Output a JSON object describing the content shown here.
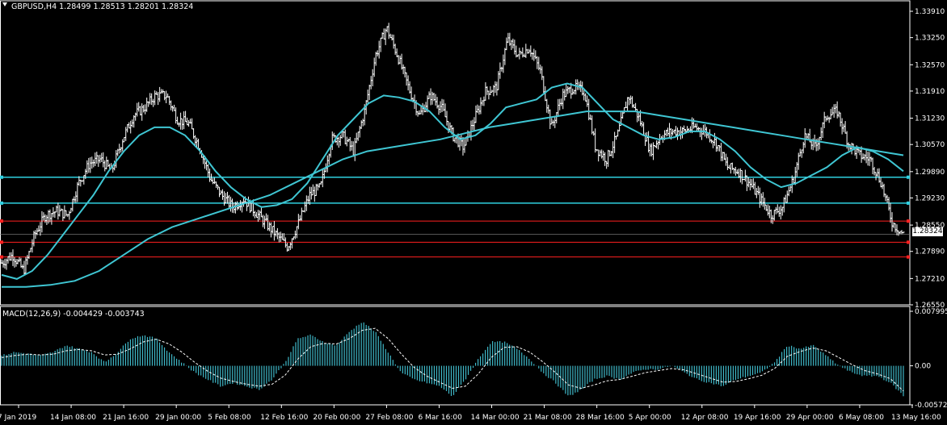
{
  "window": {
    "header": "GBPUSD,H4  1.28499 1.28513 1.28201 1.28324",
    "price_tag": "1.28324"
  },
  "indicator": {
    "header": "MACD(12,26,9) -0.004429 -0.003743"
  },
  "colors": {
    "background": "#000000",
    "candles": "#ffffff",
    "moving_average": "#3fc6d3",
    "line_cyan": "#2fd0e0",
    "line_red": "#ff2020",
    "macd_hist": "#3fb8c8",
    "signal": "#ffffff",
    "grid": "#ffffff"
  },
  "chart_data": [
    {
      "type": "line",
      "main": true,
      "y_ticks": [
        "1.33910",
        "1.33250",
        "1.32570",
        "1.31910",
        "1.31230",
        "1.30570",
        "1.29890",
        "1.29230",
        "1.28550",
        "1.27890",
        "1.27210",
        "1.26550"
      ],
      "y_tick_values": [
        1.3391,
        1.3325,
        1.3257,
        1.3191,
        1.3123,
        1.3057,
        1.2989,
        1.2923,
        1.2855,
        1.2789,
        1.2721,
        1.2655
      ],
      "ylim": [
        1.2655,
        1.3391
      ],
      "x_ticks": [
        "7 Jan 2019",
        "14 Jan 08:00",
        "21 Jan 16:00",
        "29 Jan 00:00",
        "5 Feb 08:00",
        "12 Feb 16:00",
        "20 Feb 00:00",
        "27 Feb 08:00",
        "6 Mar 16:00",
        "14 Mar 00:00",
        "21 Mar 08:00",
        "28 Mar 16:00",
        "5 Apr 00:00",
        "12 Apr 08:00",
        "19 Apr 16:00",
        "29 Apr 00:00",
        "6 May 08:00",
        "13 May 16:00"
      ],
      "close_series": [
        1.276,
        1.278,
        1.274,
        1.283,
        1.288,
        1.289,
        1.288,
        1.296,
        1.301,
        1.302,
        1.299,
        1.307,
        1.313,
        1.315,
        1.318,
        1.318,
        1.312,
        1.311,
        1.305,
        1.297,
        1.293,
        1.29,
        1.292,
        1.289,
        1.286,
        1.283,
        1.28,
        1.286,
        1.293,
        1.295,
        1.307,
        1.308,
        1.304,
        1.314,
        1.328,
        1.335,
        1.328,
        1.32,
        1.313,
        1.318,
        1.315,
        1.308,
        1.305,
        1.312,
        1.319,
        1.32,
        1.332,
        1.328,
        1.33,
        1.324,
        1.31,
        1.318,
        1.32,
        1.319,
        1.305,
        1.302,
        1.308,
        1.318,
        1.312,
        1.304,
        1.308,
        1.309,
        1.309,
        1.31,
        1.309,
        1.306,
        1.3,
        1.299,
        1.296,
        1.292,
        1.288,
        1.29,
        1.297,
        1.308,
        1.305,
        1.313,
        1.314,
        1.306,
        1.303,
        1.302,
        1.296,
        1.286,
        1.2832
      ],
      "ma_fast": [
        1.273,
        1.272,
        1.274,
        1.278,
        1.283,
        1.288,
        1.293,
        1.299,
        1.304,
        1.308,
        1.31,
        1.31,
        1.308,
        1.304,
        1.299,
        1.295,
        1.292,
        1.29,
        1.2905,
        1.292,
        1.296,
        1.302,
        1.308,
        1.312,
        1.316,
        1.318,
        1.3175,
        1.3165,
        1.314,
        1.31,
        1.307,
        1.308,
        1.311,
        1.315,
        1.316,
        1.317,
        1.32,
        1.321,
        1.32,
        1.316,
        1.312,
        1.31,
        1.308,
        1.307,
        1.3075,
        1.309,
        1.309,
        1.307,
        1.304,
        1.3,
        1.297,
        1.295,
        1.296,
        1.298,
        1.3,
        1.303,
        1.305,
        1.304,
        1.302,
        1.299
      ],
      "ma_slow": [
        1.27,
        1.27,
        1.2705,
        1.2715,
        1.274,
        1.278,
        1.282,
        1.285,
        1.287,
        1.289,
        1.291,
        1.293,
        1.296,
        1.299,
        1.302,
        1.304,
        1.305,
        1.306,
        1.307,
        1.3085,
        1.31,
        1.311,
        1.312,
        1.313,
        1.314,
        1.314,
        1.314,
        1.313,
        1.312,
        1.311,
        1.31,
        1.309,
        1.308,
        1.307,
        1.306,
        1.305,
        1.304,
        1.303
      ],
      "horizontal_lines": [
        {
          "price": 1.2975,
          "color": "cyan"
        },
        {
          "price": 1.291,
          "color": "cyan"
        },
        {
          "price": 1.2865,
          "color": "red"
        },
        {
          "price": 1.2812,
          "color": "red"
        },
        {
          "price": 1.2775,
          "color": "red"
        }
      ],
      "current_price": 1.28324
    },
    {
      "type": "bar",
      "main": false,
      "y_ticks": [
        "0.007995",
        "0.00",
        "-0.005727"
      ],
      "y_tick_values": [
        0.007995,
        0.0,
        -0.005727
      ],
      "ylim": [
        -0.005727,
        0.007995
      ],
      "histogram": [
        0.0015,
        0.002,
        0.0018,
        0.0015,
        0.002,
        0.003,
        0.0025,
        0.002,
        0.0005,
        0.002,
        0.004,
        0.0045,
        0.004,
        0.002,
        0.0005,
        -0.001,
        -0.002,
        -0.003,
        -0.0025,
        -0.003,
        -0.0035,
        -0.002,
        0.0005,
        0.004,
        0.0045,
        0.0035,
        0.003,
        0.005,
        0.0065,
        0.005,
        0.002,
        -0.001,
        -0.002,
        -0.0025,
        -0.003,
        -0.0045,
        -0.002,
        0.001,
        0.0035,
        0.0035,
        0.0025,
        0.001,
        -0.001,
        -0.0025,
        -0.0045,
        -0.0035,
        -0.002,
        -0.0015,
        -0.002,
        -0.001,
        -0.0005,
        -0.0005,
        0.0,
        -0.001,
        -0.002,
        -0.0025,
        -0.003,
        -0.002,
        -0.0015,
        -0.001,
        0.0005,
        0.003,
        0.0025,
        0.003,
        0.0015,
        0.0,
        -0.001,
        -0.0015,
        -0.0015,
        -0.0025,
        -0.0044
      ],
      "signal": [
        0.0012,
        0.0015,
        0.0017,
        0.0016,
        0.0017,
        0.0022,
        0.0024,
        0.0022,
        0.0016,
        0.0017,
        0.0025,
        0.0035,
        0.0039,
        0.0032,
        0.002,
        0.0005,
        -0.0008,
        -0.0018,
        -0.0023,
        -0.0027,
        -0.003,
        -0.0027,
        -0.0014,
        0.001,
        0.0028,
        0.0033,
        0.0032,
        0.004,
        0.0052,
        0.0055,
        0.004,
        0.0018,
        -0.0002,
        -0.0015,
        -0.0024,
        -0.0033,
        -0.003,
        -0.0012,
        0.0012,
        0.0027,
        0.0028,
        0.002,
        0.0006,
        -0.001,
        -0.0028,
        -0.0033,
        -0.0028,
        -0.0022,
        -0.002,
        -0.0015,
        -0.001,
        -0.0007,
        -0.0004,
        -0.0006,
        -0.0012,
        -0.0018,
        -0.0024,
        -0.0023,
        -0.0019,
        -0.0014,
        -0.0004,
        0.0014,
        0.0021,
        0.0026,
        0.0022,
        0.0012,
        0.0002,
        -0.0007,
        -0.0012,
        -0.0019,
        -0.0037
      ]
    }
  ]
}
